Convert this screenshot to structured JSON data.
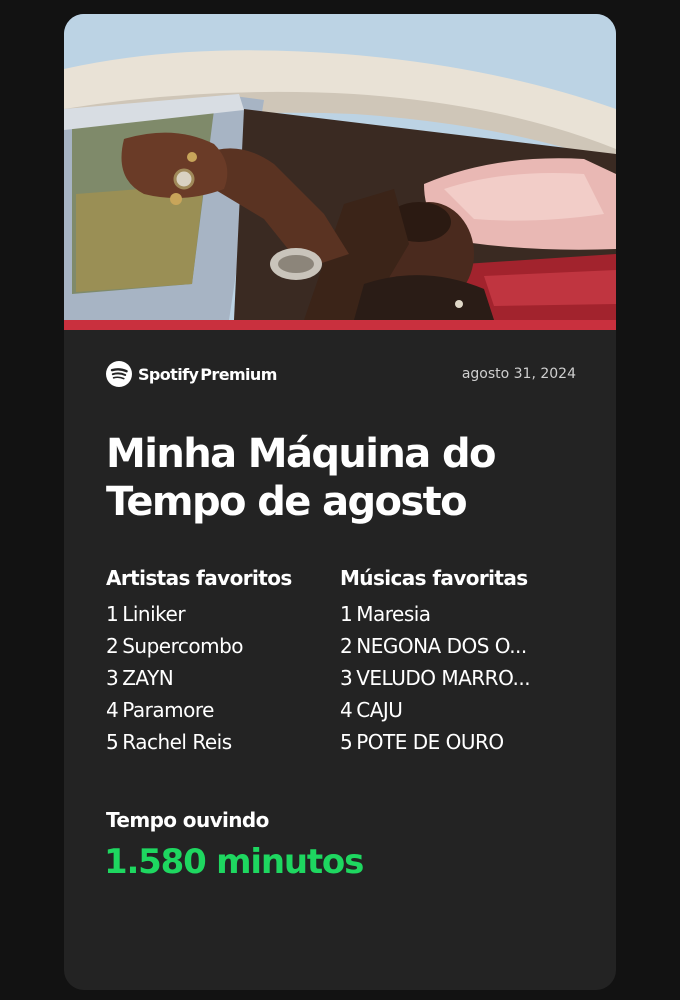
{
  "brand": {
    "name": "Spotify",
    "tier": "Premium",
    "icon": "spotify-logo-icon"
  },
  "date": "agosto 31, 2024",
  "title": "Minha Máquina do Tempo de agosto",
  "artists": {
    "heading": "Artistas favoritos",
    "items": [
      {
        "rank": "1",
        "name": "Liniker"
      },
      {
        "rank": "2",
        "name": "Supercombo"
      },
      {
        "rank": "3",
        "name": "ZAYN"
      },
      {
        "rank": "4",
        "name": "Paramore"
      },
      {
        "rank": "5",
        "name": "Rachel Reis"
      }
    ]
  },
  "songs": {
    "heading": "Músicas favoritas",
    "items": [
      {
        "rank": "1",
        "name": "Maresia"
      },
      {
        "rank": "2",
        "name": "NEGONA DOS O..."
      },
      {
        "rank": "3",
        "name": "VELUDO MARRO..."
      },
      {
        "rank": "4",
        "name": "CAJU"
      },
      {
        "rank": "5",
        "name": "POTE DE OURO"
      }
    ]
  },
  "listening": {
    "label": "Tempo ouvindo",
    "value": "1.580 minutos"
  },
  "colors": {
    "background": "#121212",
    "card": "#232323",
    "accent": "#1ed760",
    "stripe": "#c9303e"
  }
}
